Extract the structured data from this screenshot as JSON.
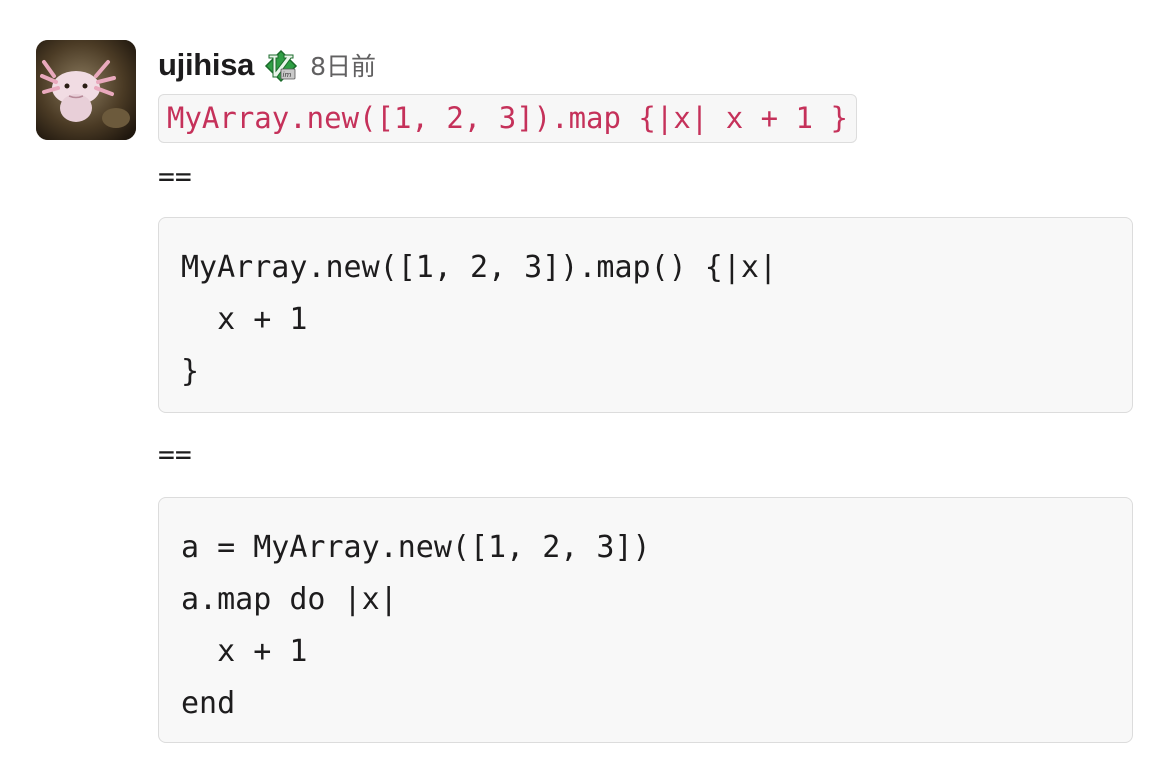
{
  "message": {
    "username": "ujihisa",
    "badge_icon": "vim-icon",
    "timestamp": "8日前",
    "inline_code": "MyArray.new([1, 2, 3]).map {|x| x + 1 }",
    "separator_1": "==",
    "code_block_1": [
      "MyArray.new([1, 2, 3]).map() {|x|",
      "  x + 1",
      "}"
    ],
    "separator_2": "==",
    "code_block_2": [
      "a = MyArray.new([1, 2, 3])",
      "a.map do |x|",
      "  x + 1",
      "end"
    ]
  },
  "colors": {
    "inline_code_text": "#c5315a",
    "badge_green": "#2f9e44"
  }
}
